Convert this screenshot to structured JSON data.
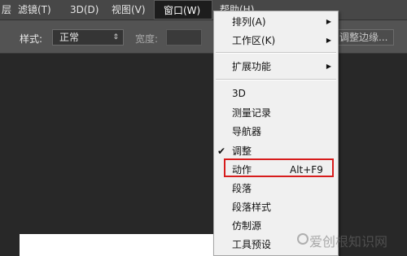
{
  "menubar": {
    "items": [
      {
        "label": "层"
      },
      {
        "label": "滤镜(T)"
      },
      {
        "label": "3D(D)"
      },
      {
        "label": "视图(V)"
      },
      {
        "label": "窗口(W)"
      },
      {
        "label": "帮助(H)"
      }
    ]
  },
  "options": {
    "style_label": "样式:",
    "style_value": "正常",
    "width_label": "宽度:",
    "adjust_edge_label": "调整边缘..."
  },
  "dropdown": {
    "items": [
      {
        "label": "排列(A)",
        "submenu": true
      },
      {
        "label": "工作区(K)",
        "submenu": true
      },
      {
        "label": "扩展功能",
        "submenu": true
      },
      {
        "label": "3D"
      },
      {
        "label": "测量记录"
      },
      {
        "label": "导航器"
      },
      {
        "label": "调整",
        "checked": true
      },
      {
        "label": "动作",
        "shortcut": "Alt+F9",
        "highlighted": true
      },
      {
        "label": "段落"
      },
      {
        "label": "段落样式"
      },
      {
        "label": "仿制源"
      },
      {
        "label": "工具预设"
      }
    ],
    "submenu_arrow": "▶",
    "check_glyph": "✔"
  },
  "watermark": {
    "text": "爱创根知识网"
  },
  "colors": {
    "highlight_border": "#d71c1c",
    "menu_bg": "#f0f0f0",
    "bar_bg": "#474747"
  }
}
